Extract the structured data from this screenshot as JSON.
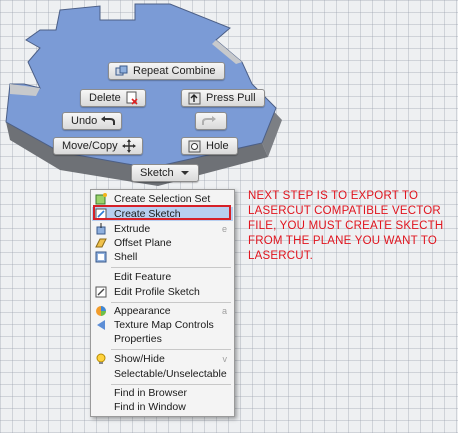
{
  "marking_menu": {
    "repeat_combine": "Repeat Combine",
    "delete": "Delete",
    "press_pull": "Press Pull",
    "undo": "Undo",
    "move_copy": "Move/Copy",
    "hole": "Hole",
    "sketch": "Sketch"
  },
  "context_menu": {
    "items": [
      {
        "label": "Create Selection Set",
        "icon": "selection-set-icon"
      },
      {
        "label": "Create Sketch",
        "icon": "create-sketch-icon",
        "highlighted": true
      },
      {
        "label": "Extrude",
        "icon": "extrude-icon",
        "shortcut": "e"
      },
      {
        "label": "Offset Plane",
        "icon": "offset-plane-icon"
      },
      {
        "label": "Shell",
        "icon": "shell-icon"
      },
      {
        "label": "Edit Feature"
      },
      {
        "label": "Edit Profile Sketch",
        "icon": "edit-profile-sketch-icon"
      },
      {
        "label": "Appearance",
        "icon": "appearance-icon",
        "shortcut": "a"
      },
      {
        "label": "Texture Map Controls",
        "icon": "texture-map-icon"
      },
      {
        "label": "Properties"
      },
      {
        "label": "Show/Hide",
        "icon": "lightbulb-icon",
        "shortcut": "v"
      },
      {
        "label": "Selectable/Unselectable"
      },
      {
        "label": "Find in Browser"
      },
      {
        "label": "Find in Window"
      }
    ]
  },
  "annotation": "NEXT STEP IS TO EXPORT TO LASERCUT COMPATIBLE VECTOR FILE, YOU MUST CREATE SKECTH FROM THE PLANE YOU WANT TO LASERCUT.",
  "colors": {
    "face_blue": "#7b9bd6",
    "highlight": "#b8cff0",
    "highlight_border": "#d62028",
    "note_red": "#e0141e"
  }
}
